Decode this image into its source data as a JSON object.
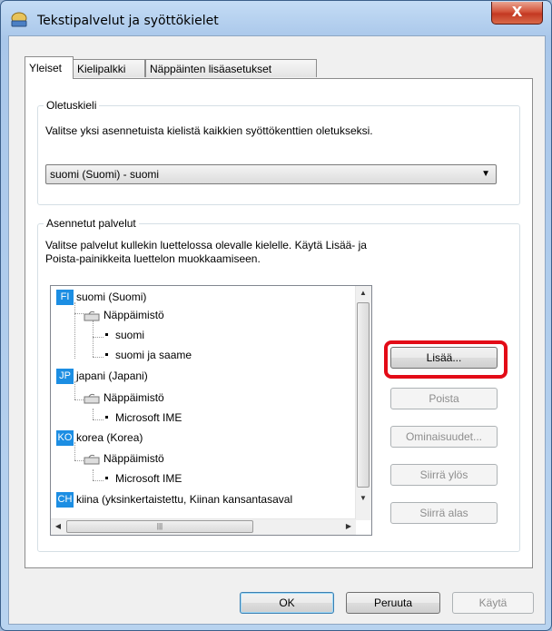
{
  "window": {
    "title": "Tekstipalvelut ja syöttökielet",
    "close_label": "X"
  },
  "tabs": [
    {
      "label": "Yleiset",
      "active": true
    },
    {
      "label": "Kielipalkki",
      "active": false
    },
    {
      "label": "Näppäinten lisäasetukset",
      "active": false
    }
  ],
  "default_language": {
    "group_label": "Oletuskieli",
    "description": "Valitse yksi asennetuista kielistä kaikkien syöttökenttien oletukseksi.",
    "selected": "suomi (Suomi) - suomi"
  },
  "installed_services": {
    "group_label": "Asennetut palvelut",
    "description_line1": "Valitse palvelut kullekin luettelossa olevalle kielelle. Käytä Lisää- ja",
    "description_line2": "Poista-painikkeita luettelon muokkaamiseen.",
    "tree": {
      "fi": {
        "badge": "FI",
        "label": "suomi (Suomi)",
        "category": "Näppäimistö",
        "items": [
          "suomi",
          "suomi ja saame"
        ]
      },
      "jp": {
        "badge": "JP",
        "label": "japani (Japani)",
        "category": "Näppäimistö",
        "items": [
          "Microsoft IME"
        ]
      },
      "ko": {
        "badge": "KO",
        "label": "korea (Korea)",
        "category": "Näppäimistö",
        "items": [
          "Microsoft IME"
        ]
      },
      "ch": {
        "badge": "CH",
        "label": "kiina (yksinkertaistettu, Kiinan kansantasaval"
      }
    },
    "buttons": {
      "add": "Lisää...",
      "remove": "Poista",
      "properties": "Ominaisuudet...",
      "move_up": "Siirrä ylös",
      "move_down": "Siirrä alas"
    }
  },
  "footer": {
    "ok": "OK",
    "cancel": "Peruuta",
    "apply": "Käytä"
  },
  "colors": {
    "highlight": "#e30b17",
    "lang_badge": "#1c8ee3"
  }
}
